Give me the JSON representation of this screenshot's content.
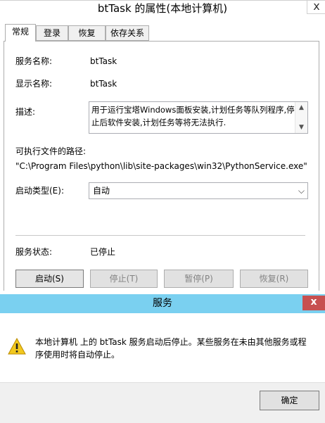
{
  "window": {
    "title": "btTask 的属性(本地计算机)",
    "close_glyph": "x"
  },
  "tabs": [
    {
      "label": "常规"
    },
    {
      "label": "登录"
    },
    {
      "label": "恢复"
    },
    {
      "label": "依存关系"
    }
  ],
  "general": {
    "service_name_label": "服务名称:",
    "service_name": "btTask",
    "display_name_label": "显示名称:",
    "display_name": "btTask",
    "description_label": "描述:",
    "description": "用于运行宝塔Windows面板安装,计划任务等队列程序,停止后软件安装,计划任务等将无法执行.",
    "exe_path_label": "可执行文件的路径:",
    "exe_path": "\"C:\\Program Files\\python\\lib\\site-packages\\win32\\PythonService.exe\"",
    "startup_type_label": "启动类型(E):",
    "startup_type": "自动",
    "status_label": "服务状态:",
    "status": "已停止",
    "buttons": {
      "start": "启动(S)",
      "stop": "停止(T)",
      "pause": "暂停(P)",
      "resume": "恢复(R)"
    }
  },
  "message_dialog": {
    "title": "服务",
    "close_glyph": "x",
    "message": "本地计算机 上的 btTask 服务启动后停止。某些服务在未由其他服务或程序使用时将自动停止。",
    "ok_label": "确定",
    "icon": "warning-icon"
  },
  "colors": {
    "dialog_titlebar": "#7ad0f0",
    "close_button": "#c75050",
    "warning_fill": "#f2c81e"
  }
}
